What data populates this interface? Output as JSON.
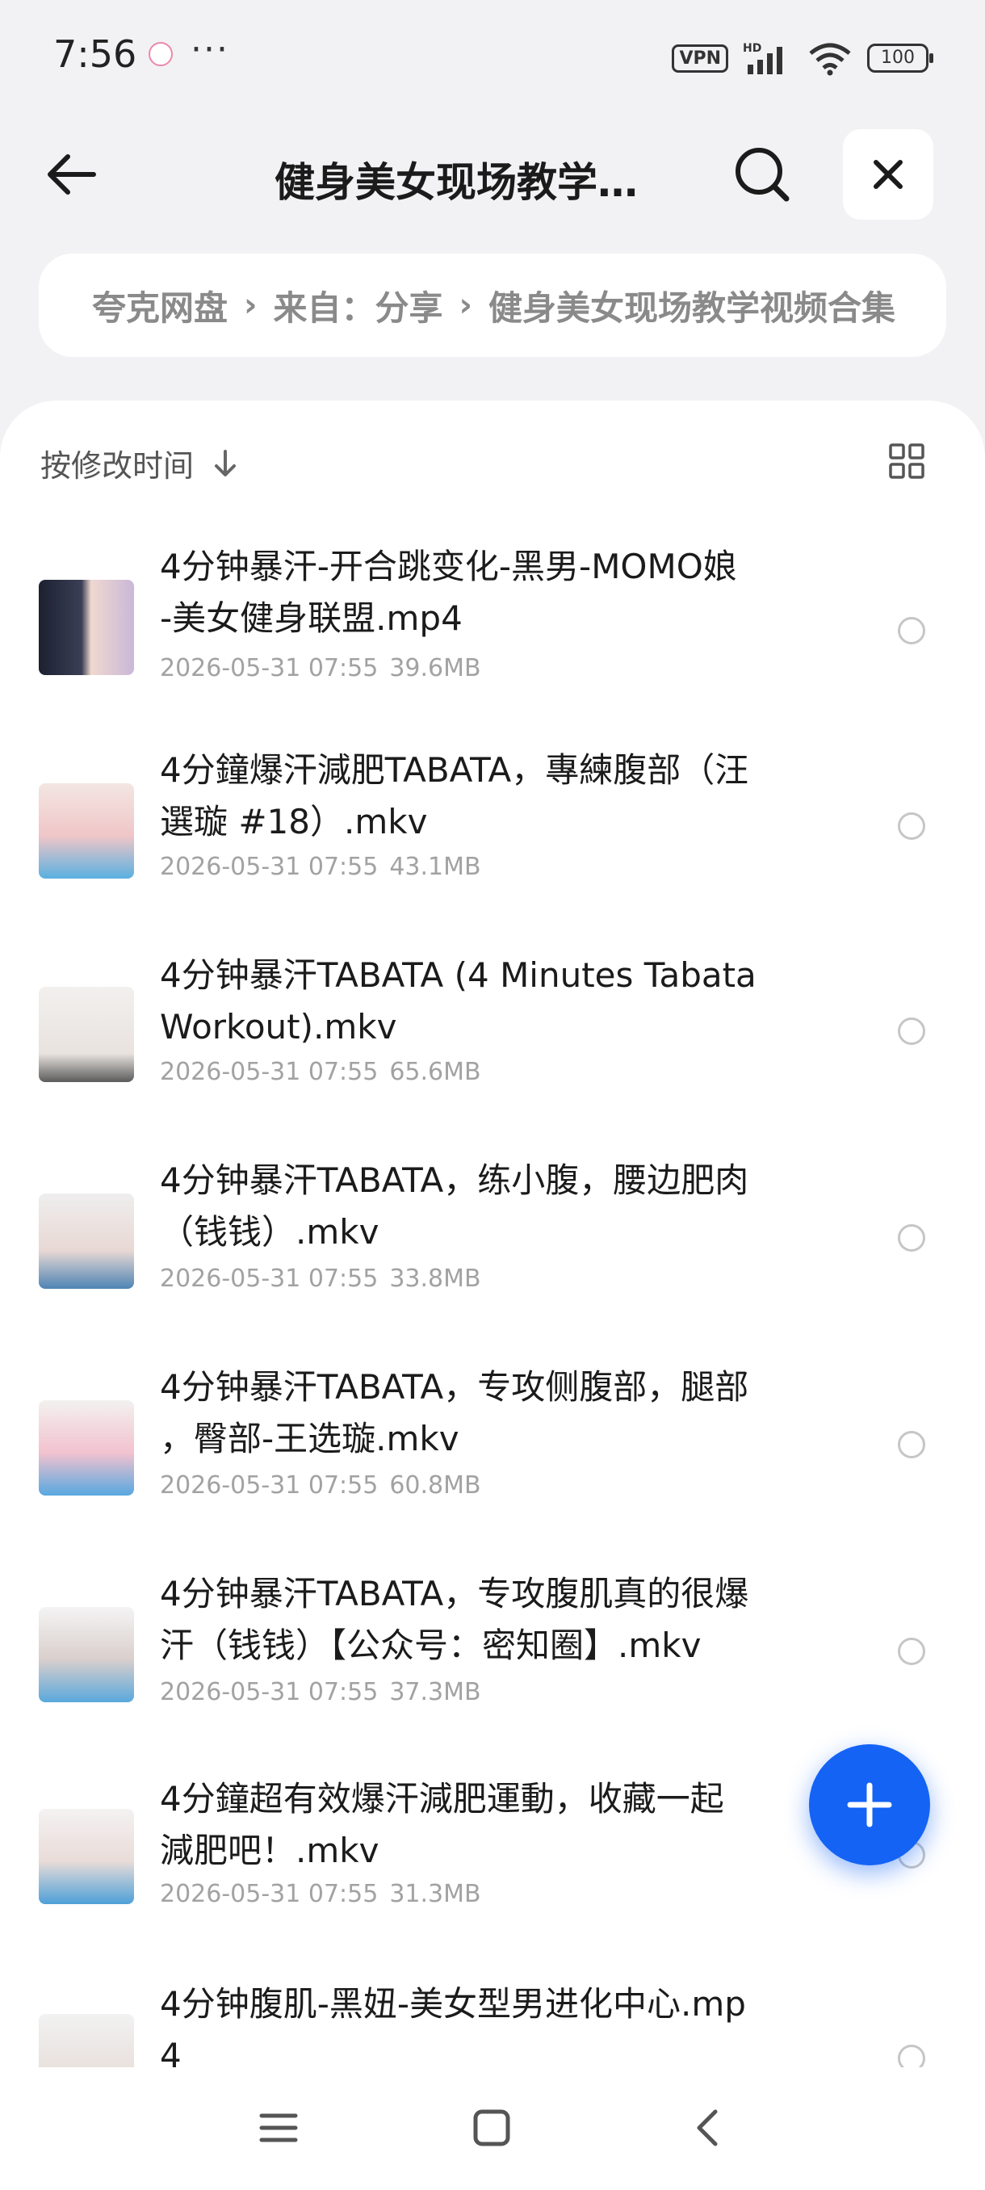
{
  "status": {
    "time": "7:56",
    "more": "···",
    "vpn": "VPN",
    "battery": "100"
  },
  "header": {
    "title": "健身美女现场教学…"
  },
  "breadcrumb": {
    "items": [
      "夸克网盘",
      "来自：分享",
      "健身美女现场教学视频合集"
    ]
  },
  "toolbar": {
    "sort_label": "按修改时间"
  },
  "files": [
    {
      "line1": "4分钟暴汗-开合跳变化-黑男-MOMO娘",
      "line2": "-美女健身联盟.mp4",
      "date": "2026-05-31 07:55",
      "size": "39.6MB"
    },
    {
      "line1": "4分鐘爆汗減肥TABATA，專練腹部（汪",
      "line2": "選璇 #18）.mkv",
      "date": "2026-05-31 07:55",
      "size": "43.1MB"
    },
    {
      "line1": "4分钟暴汗TABATA (4 Minutes Tabata",
      "line2": "Workout).mkv",
      "date": "2026-05-31 07:55",
      "size": "65.6MB"
    },
    {
      "line1": "4分钟暴汗TABATA，练小腹，腰边肥肉",
      "line2": "（钱钱）.mkv",
      "date": "2026-05-31 07:55",
      "size": "33.8MB"
    },
    {
      "line1": "4分钟暴汗TABATA，专攻侧腹部，腿部",
      "line2": "，臀部-王选璇.mkv",
      "date": "2026-05-31 07:55",
      "size": "60.8MB"
    },
    {
      "line1": "4分钟暴汗TABATA，专攻腹肌真的很爆",
      "line2": "汗（钱钱）【公众号：密知圈】.mkv",
      "date": "2026-05-31 07:55",
      "size": "37.3MB"
    },
    {
      "line1": "4分鐘超有效爆汗減肥運動，收藏一起",
      "line2": "減肥吧！.mkv",
      "date": "2026-05-31 07:55",
      "size": "31.3MB"
    },
    {
      "line1": "4分钟腹肌-黑妞-美女型男进化中心.mp",
      "line2": "4",
      "date": "",
      "size": ""
    }
  ],
  "colors": {
    "accent": "#1463f5",
    "background": "#f2f2f4",
    "meta_text": "#a2a2a2"
  }
}
